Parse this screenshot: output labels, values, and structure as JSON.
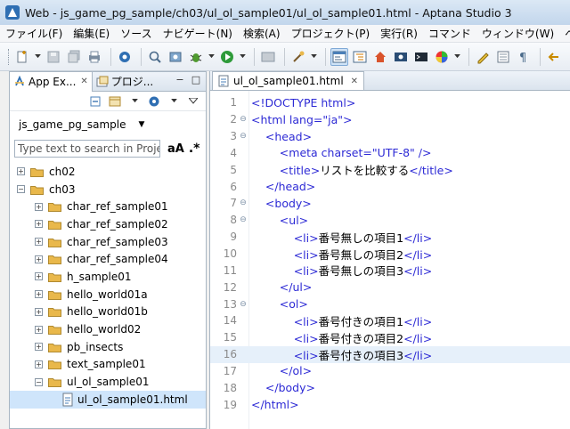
{
  "window": {
    "title": "Web - js_game_pg_sample/ch03/ul_ol_sample01/ul_ol_sample01.html - Aptana Studio 3"
  },
  "menu": [
    "ファイル(F)",
    "編集(E)",
    "ソース",
    "ナビゲート(N)",
    "検索(A)",
    "プロジェクト(P)",
    "実行(R)",
    "コマンド",
    "ウィンドウ(W)",
    "ヘル"
  ],
  "left_panel": {
    "tabs": [
      {
        "label": "App Ex..."
      },
      {
        "label": "プロジ..."
      }
    ],
    "project_selector": "js_game_pg_sample",
    "filter": {
      "placeholder": "Type text to search in Project",
      "case_label": "aA",
      "regex_label": ".*"
    },
    "tree": [
      {
        "label": "ch02",
        "expander": "+",
        "kind": "folder",
        "indent": 0
      },
      {
        "label": "ch03",
        "expander": "−",
        "kind": "folder",
        "indent": 0
      },
      {
        "label": "char_ref_sample01",
        "expander": "+",
        "kind": "folder",
        "indent": 1
      },
      {
        "label": "char_ref_sample02",
        "expander": "+",
        "kind": "folder",
        "indent": 1
      },
      {
        "label": "char_ref_sample03",
        "expander": "+",
        "kind": "folder",
        "indent": 1
      },
      {
        "label": "char_ref_sample04",
        "expander": "+",
        "kind": "folder",
        "indent": 1
      },
      {
        "label": "h_sample01",
        "expander": "+",
        "kind": "folder",
        "indent": 1
      },
      {
        "label": "hello_world01a",
        "expander": "+",
        "kind": "folder",
        "indent": 1
      },
      {
        "label": "hello_world01b",
        "expander": "+",
        "kind": "folder",
        "indent": 1
      },
      {
        "label": "hello_world02",
        "expander": "+",
        "kind": "folder",
        "indent": 1
      },
      {
        "label": "pb_insects",
        "expander": "+",
        "kind": "folder",
        "indent": 1
      },
      {
        "label": "text_sample01",
        "expander": "+",
        "kind": "folder",
        "indent": 1
      },
      {
        "label": "ul_ol_sample01",
        "expander": "−",
        "kind": "folder",
        "indent": 1
      },
      {
        "label": "ul_ol_sample01.html",
        "expander": "",
        "kind": "file",
        "indent": 2,
        "selected": true
      }
    ]
  },
  "editor": {
    "tab_label": "ul_ol_sample01.html",
    "highlighted_line": 16,
    "lines": [
      {
        "num": "1",
        "fold": "",
        "text": "<!DOCTYPE html>"
      },
      {
        "num": "2",
        "fold": "⊖",
        "text": "<html lang=\"ja\">"
      },
      {
        "num": "3",
        "fold": "⊖",
        "text": "    <head>"
      },
      {
        "num": "4",
        "fold": "",
        "text": "        <meta charset=\"UTF-8\" />"
      },
      {
        "num": "5",
        "fold": "",
        "text": "        <title>リストを比較する</title>"
      },
      {
        "num": "6",
        "fold": "",
        "text": "    </head>"
      },
      {
        "num": "7",
        "fold": "⊖",
        "text": "    <body>"
      },
      {
        "num": "8",
        "fold": "⊖",
        "text": "        <ul>"
      },
      {
        "num": "9",
        "fold": "",
        "text": "            <li>番号無しの項目1</li>"
      },
      {
        "num": "10",
        "fold": "",
        "text": "            <li>番号無しの項目2</li>"
      },
      {
        "num": "11",
        "fold": "",
        "text": "            <li>番号無しの項目3</li>"
      },
      {
        "num": "12",
        "fold": "",
        "text": "        </ul>"
      },
      {
        "num": "13",
        "fold": "⊖",
        "text": "        <ol>"
      },
      {
        "num": "14",
        "fold": "",
        "text": "            <li>番号付きの項目1</li>"
      },
      {
        "num": "15",
        "fold": "",
        "text": "            <li>番号付きの項目2</li>"
      },
      {
        "num": "16",
        "fold": "",
        "text": "            <li>番号付きの項目3</li>"
      },
      {
        "num": "17",
        "fold": "",
        "text": "        </ol>"
      },
      {
        "num": "18",
        "fold": "",
        "text": "    </body>"
      },
      {
        "num": "19",
        "fold": "",
        "text": "</html>"
      }
    ]
  },
  "colors": {
    "tag": "#2d2ad5",
    "selection": "#cfe5fb",
    "current_line": "#e6f0fa",
    "folder": "#e9b84b"
  }
}
